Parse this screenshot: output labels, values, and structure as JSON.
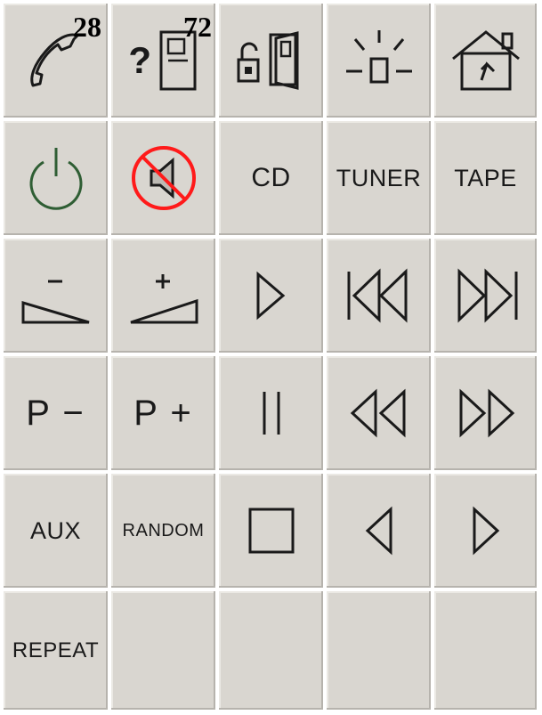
{
  "overlay": {
    "left_number": "28",
    "right_number": "72"
  },
  "buttons": {
    "phone": {
      "icon": "phone-icon"
    },
    "help_device": {
      "icon": "help-device-icon",
      "glyph": "?"
    },
    "lock_door": {
      "icon": "unlock-door-icon"
    },
    "light": {
      "icon": "light-icon"
    },
    "home": {
      "icon": "home-icon"
    },
    "power": {
      "icon": "power-icon"
    },
    "mute": {
      "icon": "mute-icon",
      "color": "#ff1a1a"
    },
    "cd": {
      "label": "CD"
    },
    "tuner": {
      "label": "TUNER"
    },
    "tape": {
      "label": "TAPE"
    },
    "volume_down": {
      "icon": "volume-down-icon",
      "glyph": "−"
    },
    "volume_up": {
      "icon": "volume-up-icon",
      "glyph": "+"
    },
    "play": {
      "icon": "play-icon"
    },
    "previous_track": {
      "icon": "skip-previous-icon"
    },
    "next_track": {
      "icon": "skip-next-icon"
    },
    "preset_down": {
      "label": "P −"
    },
    "preset_up": {
      "label": "P +"
    },
    "pause": {
      "icon": "pause-icon"
    },
    "rewind": {
      "icon": "rewind-icon"
    },
    "fast_forward": {
      "icon": "fast-forward-icon"
    },
    "aux": {
      "label": "AUX"
    },
    "random": {
      "label": "RANDOM"
    },
    "stop": {
      "icon": "stop-icon"
    },
    "left": {
      "icon": "left-arrow-icon"
    },
    "right": {
      "icon": "right-arrow-icon"
    },
    "repeat": {
      "label": "REPEAT"
    }
  },
  "colors": {
    "button_face": "#d9d6d0",
    "power_green": "#2f5e34",
    "mute_red": "#ff1a1a",
    "background": "#ffffff"
  }
}
